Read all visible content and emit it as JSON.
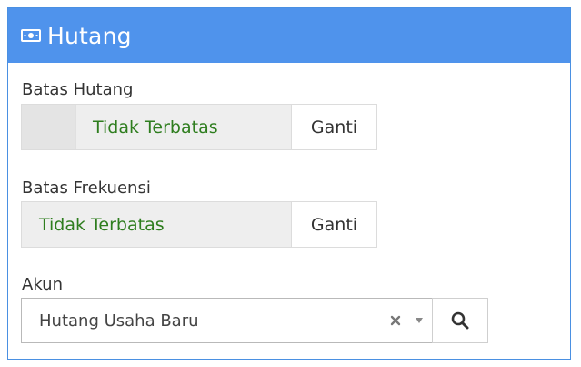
{
  "panel": {
    "title": "Hutang",
    "icon": "money-bill-icon",
    "header_color": "#4f93ec"
  },
  "fields": {
    "batas_hutang": {
      "label": "Batas Hutang",
      "value": "Tidak Terbatas",
      "button_label": "Ganti"
    },
    "batas_frekuensi": {
      "label": "Batas Frekuensi",
      "value": "Tidak Terbatas",
      "button_label": "Ganti"
    },
    "akun": {
      "label": "Akun",
      "selected": "Hutang Usaha Baru",
      "clear_icon": "clear-x-icon",
      "caret_icon": "caret-down-icon",
      "search_icon": "search-icon"
    }
  },
  "colors": {
    "value_text": "#2e7d1e",
    "readonly_bg": "#eeeeee"
  }
}
